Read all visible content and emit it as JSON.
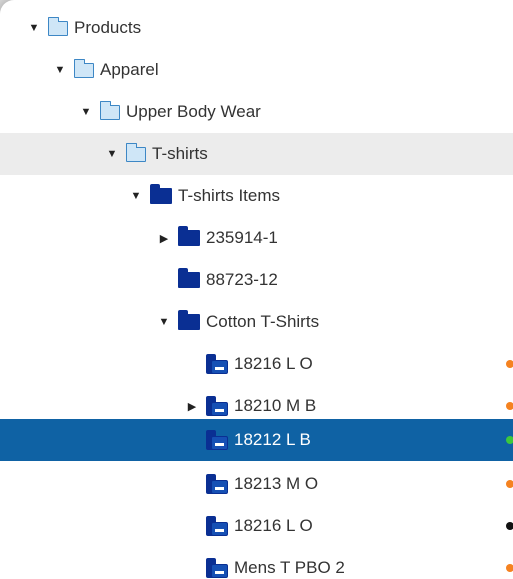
{
  "tree": {
    "nodes": [
      {
        "label": "Products",
        "icon": "folder-open-light-icon",
        "expanded": true
      },
      {
        "label": "Apparel",
        "icon": "folder-open-light-icon",
        "expanded": true
      },
      {
        "label": "Upper Body Wear",
        "icon": "folder-open-light-icon",
        "expanded": true
      },
      {
        "label": "T-shirts",
        "icon": "folder-open-light-icon",
        "expanded": true
      },
      {
        "label": "T-shirts Items",
        "icon": "folder-dark-icon",
        "expanded": true
      },
      {
        "label": "235914-1",
        "icon": "folder-dark-icon",
        "expanded": false
      },
      {
        "label": "88723-12",
        "icon": "folder-dark-icon"
      },
      {
        "label": "Cotton T-Shirts",
        "icon": "folder-dark-icon",
        "expanded": true
      },
      {
        "label": "18216 L O",
        "icon": "product-icon",
        "status_color": "#f58220"
      },
      {
        "label": "18210 M B",
        "icon": "product-icon",
        "expanded": false,
        "status_color": "#f58220"
      },
      {
        "label": "18212 L B",
        "icon": "product-icon",
        "status_color": "#3cc83c",
        "selected": true
      },
      {
        "label": "18213 M O",
        "icon": "product-icon",
        "status_color": "#f58220"
      },
      {
        "label": "18216 L O",
        "icon": "product-icon",
        "status_color": "#111111"
      },
      {
        "label": "Mens T PBO 2",
        "icon": "product-icon",
        "status_color": "#f58220"
      }
    ]
  },
  "colors": {
    "selection": "#0f62a4",
    "hover": "#ececec",
    "folder_dark": "#0a2f93",
    "folder_light": "#cfe6f7"
  }
}
